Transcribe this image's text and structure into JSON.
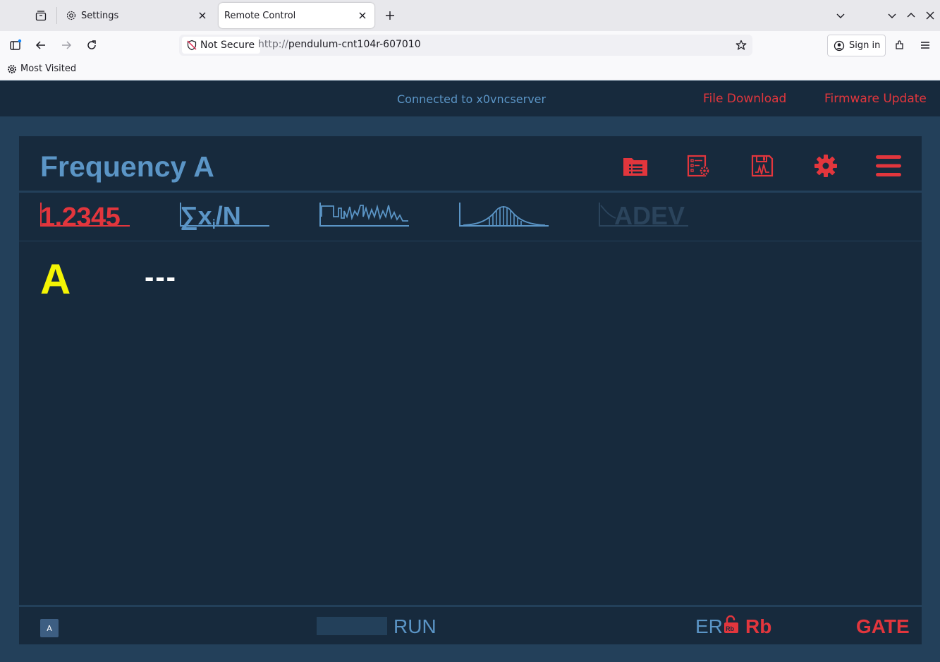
{
  "browser": {
    "tabs": [
      {
        "label": "Settings",
        "active": false
      },
      {
        "label": "Remote Control",
        "active": true
      }
    ],
    "url_security": "Not Secure",
    "url_protocol": "http://",
    "url_host": "pendulum-cnt104r-607010",
    "sign_in": "Sign in",
    "bookmarks": [
      {
        "label": "Most Visited"
      }
    ]
  },
  "app": {
    "connection_status": "Connected to x0vncserver",
    "links": {
      "file_download": "File Download",
      "firmware_update": "Firmware Update"
    },
    "panel_title": "Frequency A",
    "toolbar": {
      "numeric_label": "1.2345",
      "stats_label": "∑xi/N",
      "adev_label": "ADEV"
    },
    "measurement": {
      "channel": "A",
      "value": "---"
    },
    "status_bar": {
      "channel_badge": "A",
      "run_state": "RUN",
      "er_label": "ER",
      "rb_label": "Rb",
      "lock_badge": "Rb",
      "gate_label": "GATE"
    }
  },
  "colors": {
    "page_bg": "#23405a",
    "panel_bg": "#172a3d",
    "accent_blue": "#5b95c6",
    "accent_red": "#e2363d",
    "channel_yellow": "#f4f404"
  }
}
